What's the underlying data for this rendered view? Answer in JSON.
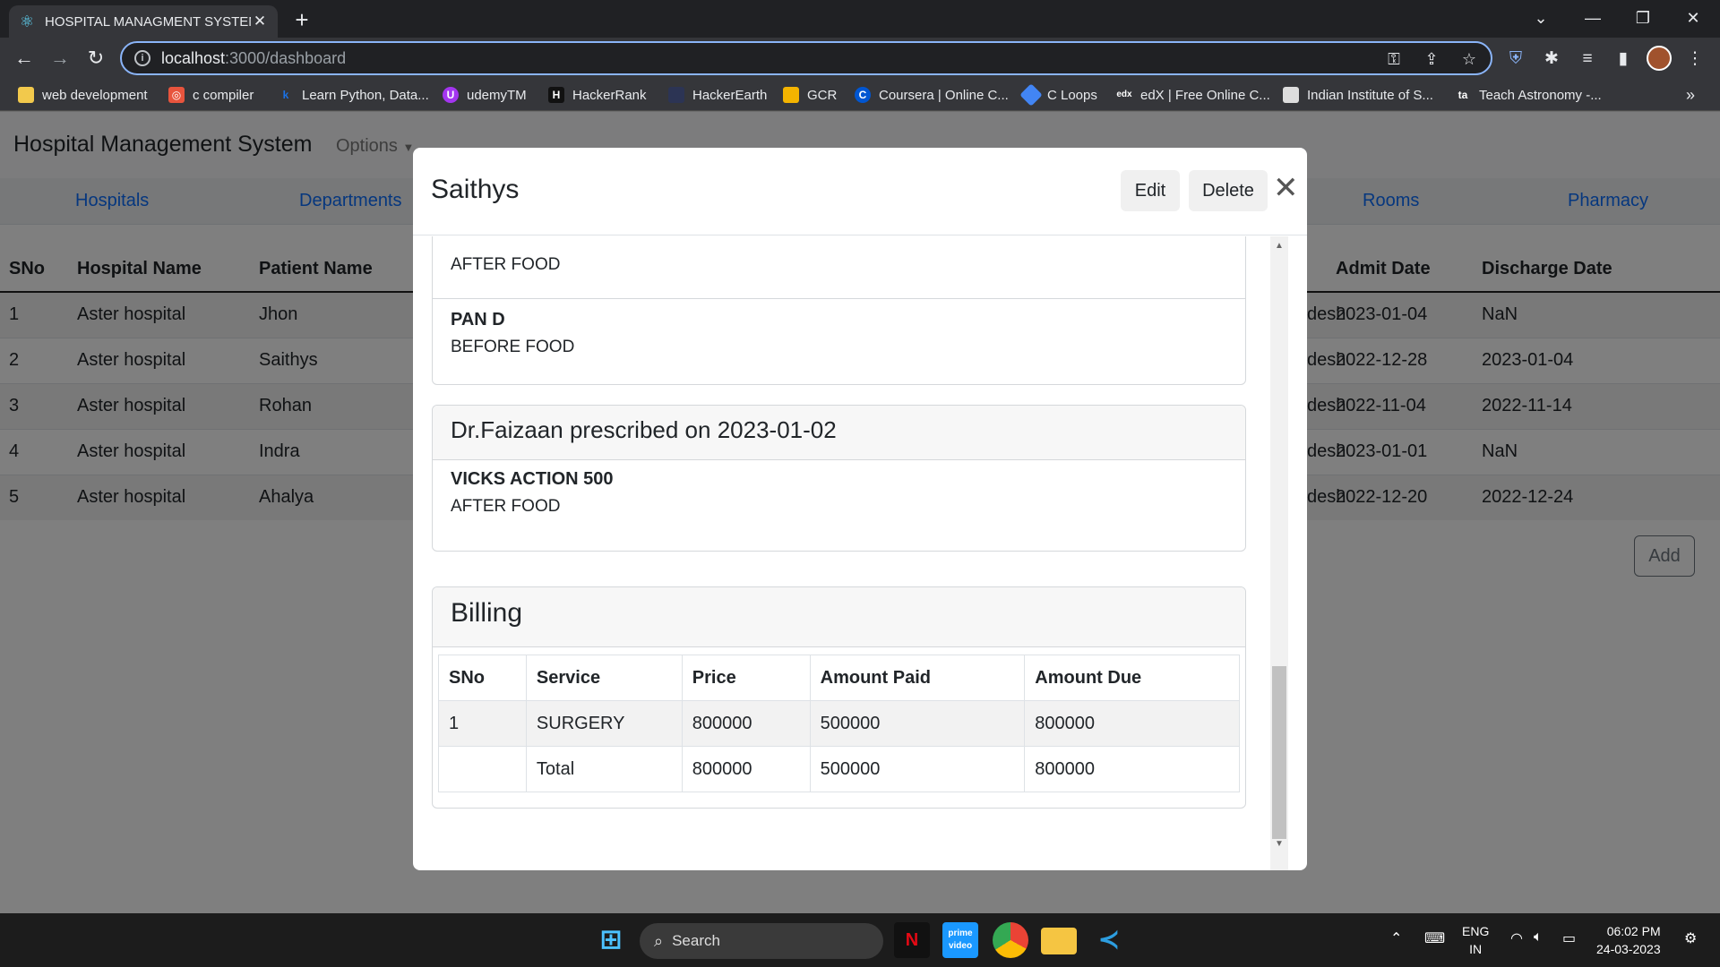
{
  "browser": {
    "tab_title": "HOSPITAL MANAGMENT SYSTEM",
    "url_host": "localhost",
    "url_path": ":3000/dashboard",
    "bookmarks": [
      {
        "label": "web development",
        "icon": "folder-icon",
        "color": "#f2c94c"
      },
      {
        "label": "c compiler",
        "icon": "compiler-icon",
        "color": "#e8543d"
      },
      {
        "label": "Learn Python, Data...",
        "icon": "k-icon",
        "color": "#1a73e8"
      },
      {
        "label": "udemyTM",
        "icon": "udemy-icon",
        "color": "#a435f0"
      },
      {
        "label": "HackerRank",
        "icon": "hackerrank-icon",
        "color": "#111111"
      },
      {
        "label": "HackerEarth",
        "icon": "hackerearth-icon",
        "color": "#2c3454"
      },
      {
        "label": "GCR",
        "icon": "classroom-icon",
        "color": "#f4b400"
      },
      {
        "label": "Coursera | Online C...",
        "icon": "coursera-icon",
        "color": "#0056d2"
      },
      {
        "label": "C Loops",
        "icon": "cloops-icon",
        "color": "#4285f4"
      },
      {
        "label": "edX | Free Online C...",
        "icon": "edx-icon",
        "color": "#35363a"
      },
      {
        "label": "Indian Institute of S...",
        "icon": "iis-icon",
        "color": "#dddddd"
      },
      {
        "label": "Teach Astronomy -...",
        "icon": "ta-icon",
        "color": "#35363a"
      }
    ]
  },
  "app": {
    "brand": "Hospital Management System",
    "options_label": "Options",
    "nav": [
      "Hospitals",
      "Departments",
      "Rooms",
      "Pharmacy"
    ],
    "table": {
      "headers": [
        "SNo",
        "Hospital Name",
        "Patient Name",
        "Admit Date",
        "Discharge Date"
      ],
      "rows": [
        {
          "sno": "1",
          "hospital": "Aster hospital",
          "patient": "Jhon",
          "state": "desh",
          "admit": "2023-01-04",
          "discharge": "NaN"
        },
        {
          "sno": "2",
          "hospital": "Aster hospital",
          "patient": "Saithys",
          "state": "desh",
          "admit": "2022-12-28",
          "discharge": "2023-01-04"
        },
        {
          "sno": "3",
          "hospital": "Aster hospital",
          "patient": "Rohan",
          "state": "desh",
          "admit": "2022-11-04",
          "discharge": "2022-11-14"
        },
        {
          "sno": "4",
          "hospital": "Aster hospital",
          "patient": "Indra",
          "state": "desh",
          "admit": "2023-01-01",
          "discharge": "NaN"
        },
        {
          "sno": "5",
          "hospital": "Aster hospital",
          "patient": "Ahalya",
          "state": "desh",
          "admit": "2022-12-20",
          "discharge": "2022-12-24"
        }
      ]
    },
    "add_label": "Add"
  },
  "modal": {
    "title": "Saithys",
    "edit_label": "Edit",
    "delete_label": "Delete",
    "prev_card": {
      "partial_timing": "AFTER FOOD",
      "medicine": "PAN D",
      "timing": "BEFORE FOOD"
    },
    "prescription": {
      "header": "Dr.Faizaan prescribed on 2023-01-02",
      "medicine": "VICKS ACTION 500",
      "timing": "AFTER FOOD"
    },
    "billing": {
      "title": "Billing",
      "headers": [
        "SNo",
        "Service",
        "Price",
        "Amount Paid",
        "Amount Due"
      ],
      "rows": [
        {
          "sno": "1",
          "service": "SURGERY",
          "price": "800000",
          "paid": "500000",
          "due": "800000"
        },
        {
          "sno": "",
          "service": "Total",
          "price": "800000",
          "paid": "500000",
          "due": "800000"
        }
      ]
    }
  },
  "taskbar": {
    "search_label": "Search",
    "lang": "ENG",
    "region": "IN",
    "time": "06:02 PM",
    "date": "24-03-2023"
  }
}
